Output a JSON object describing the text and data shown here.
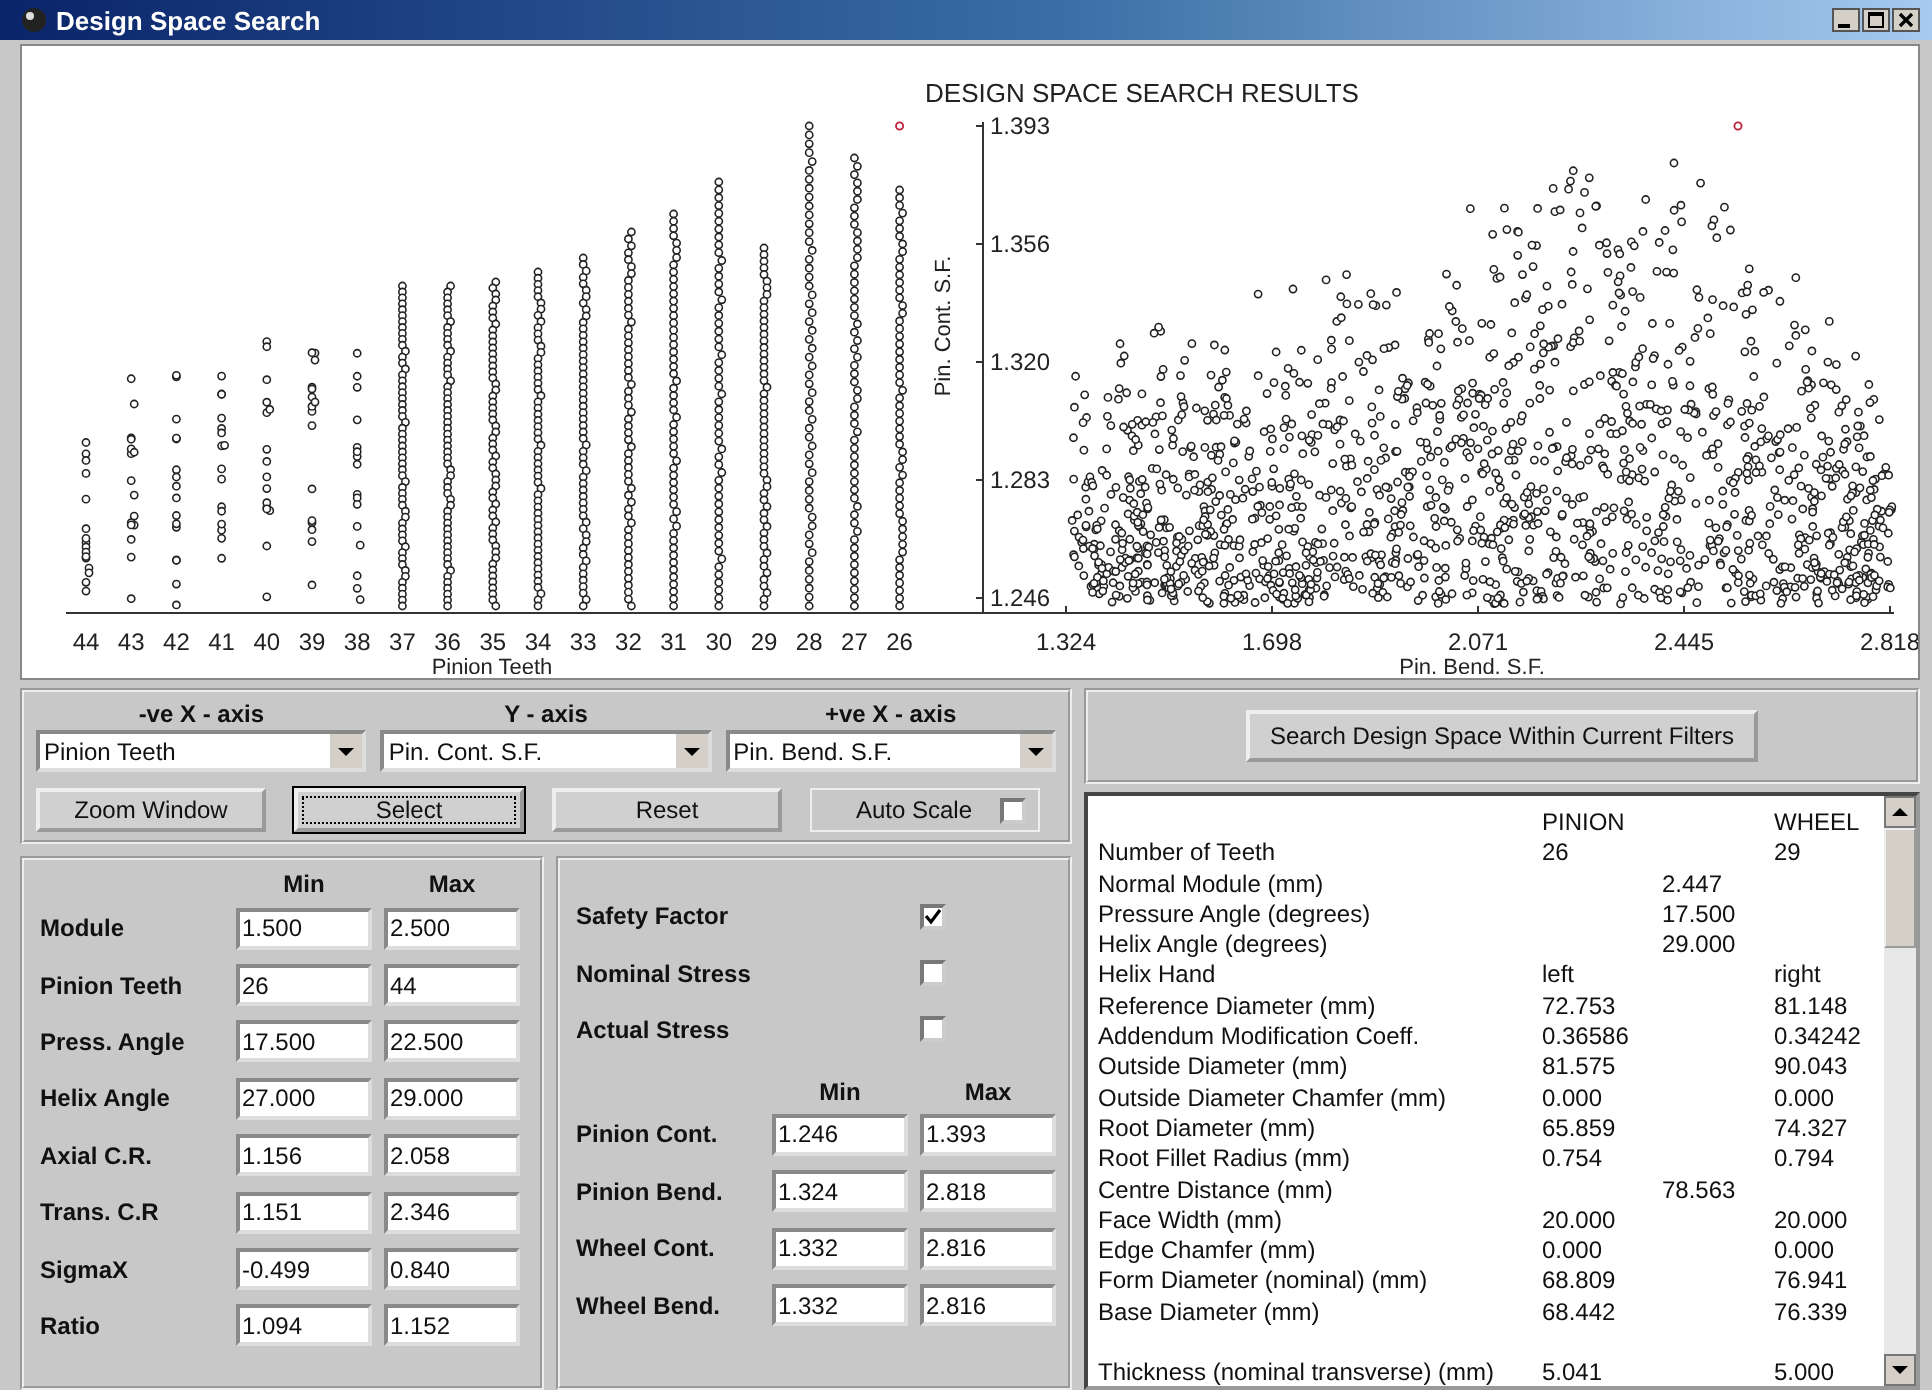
{
  "window": {
    "title": "Design Space Search"
  },
  "plot": {
    "title": "DESIGN SPACE SEARCH RESULTS",
    "left_chart": {
      "xlabel": "Pinion Teeth",
      "ylabel": "Pin. Cont. S.F.",
      "xticks": [
        "44",
        "43",
        "42",
        "41",
        "40",
        "39",
        "38",
        "37",
        "36",
        "35",
        "34",
        "33",
        "32",
        "31",
        "30",
        "29",
        "28",
        "27",
        "26"
      ],
      "yticks": [
        "1.393",
        "1.356",
        "1.320",
        "1.283",
        "1.246"
      ]
    },
    "right_chart": {
      "xlabel": "Pin. Bend. S.F.",
      "xticks": [
        "1.324",
        "1.698",
        "2.071",
        "2.445",
        "2.818"
      ]
    }
  },
  "axes": [
    {
      "label": "-ve X - axis",
      "value": "Pinion Teeth"
    },
    {
      "label": "Y - axis",
      "value": "Pin. Cont. S.F."
    },
    {
      "label": "+ve X - axis",
      "value": "Pin. Bend. S.F."
    }
  ],
  "buttons": [
    {
      "label": "Zoom Window",
      "focused": false
    },
    {
      "label": "Select",
      "focused": true
    },
    {
      "label": "Reset",
      "focused": false
    }
  ],
  "auto_scale": {
    "label": "Auto Scale",
    "checked": false
  },
  "filters": {
    "headers": [
      "Min",
      "Max"
    ],
    "rows": [
      {
        "label": "Module",
        "min": "1.500",
        "max": "2.500"
      },
      {
        "label": "Pinion Teeth",
        "min": "26",
        "max": "44"
      },
      {
        "label": "Press. Angle",
        "min": "17.500",
        "max": "22.500"
      },
      {
        "label": "Helix Angle",
        "min": "27.000",
        "max": "29.000"
      },
      {
        "label": "Axial C.R.",
        "min": "1.156",
        "max": "2.058"
      },
      {
        "label": "Trans. C.R",
        "min": "1.151",
        "max": "2.346"
      },
      {
        "label": "SigmaX",
        "min": "-0.499",
        "max": "0.840"
      },
      {
        "label": "Ratio",
        "min": "1.094",
        "max": "1.152"
      }
    ]
  },
  "display": {
    "options": [
      {
        "label": "Safety Factor",
        "checked": true
      },
      {
        "label": "Nominal Stress",
        "checked": false
      },
      {
        "label": "Actual Stress",
        "checked": false
      }
    ],
    "headers": [
      "Min",
      "Max"
    ],
    "rows": [
      {
        "label": "Pinion Cont.",
        "min": "1.246",
        "max": "1.393"
      },
      {
        "label": "Pinion Bend.",
        "min": "1.324",
        "max": "2.818"
      },
      {
        "label": "Wheel Cont.",
        "min": "1.332",
        "max": "2.816"
      },
      {
        "label": "Wheel Bend.",
        "min": "1.332",
        "max": "2.816"
      }
    ]
  },
  "search_button": "Search Design Space Within Current Filters",
  "results": {
    "headers": [
      "PINION",
      "WHEEL"
    ],
    "rows": [
      {
        "kind": "pair",
        "label": "Number of Teeth",
        "pinion": "26",
        "wheel": "29"
      },
      {
        "kind": "shared",
        "label": "Normal Module (mm)",
        "value": "2.447"
      },
      {
        "kind": "shared",
        "label": "Pressure Angle (degrees)",
        "value": "17.500"
      },
      {
        "kind": "shared",
        "label": "Helix Angle (degrees)",
        "value": "29.000"
      },
      {
        "kind": "pair",
        "label": "Helix Hand",
        "pinion": "left",
        "wheel": "right"
      },
      {
        "kind": "pair",
        "label": "Reference Diameter (mm)",
        "pinion": "72.753",
        "wheel": "81.148"
      },
      {
        "kind": "pair",
        "label": "Addendum Modification Coeff.",
        "pinion": "0.36586",
        "wheel": "0.34242"
      },
      {
        "kind": "pair",
        "label": "Outside Diameter (mm)",
        "pinion": "81.575",
        "wheel": "90.043"
      },
      {
        "kind": "pair",
        "label": "Outside Diameter Chamfer (mm)",
        "pinion": "0.000",
        "wheel": "0.000"
      },
      {
        "kind": "pair",
        "label": "Root Diameter (mm)",
        "pinion": "65.859",
        "wheel": "74.327"
      },
      {
        "kind": "pair",
        "label": "Root Fillet Radius (mm)",
        "pinion": "0.754",
        "wheel": "0.794"
      },
      {
        "kind": "shared",
        "label": "Centre Distance (mm)",
        "value": "78.563"
      },
      {
        "kind": "pair",
        "label": "Face Width (mm)",
        "pinion": "20.000",
        "wheel": "20.000"
      },
      {
        "kind": "pair",
        "label": "Edge Chamfer (mm)",
        "pinion": "0.000",
        "wheel": "0.000"
      },
      {
        "kind": "pair",
        "label": "Form Diameter (nominal) (mm)",
        "pinion": "68.809",
        "wheel": "76.941"
      },
      {
        "kind": "pair",
        "label": "Base Diameter (mm)",
        "pinion": "68.442",
        "wheel": "76.339"
      },
      {
        "kind": "blank"
      },
      {
        "kind": "pair",
        "label": "Thickness (nominal transverse) (mm)",
        "pinion": "5.041",
        "wheel": "5.000"
      }
    ]
  }
}
